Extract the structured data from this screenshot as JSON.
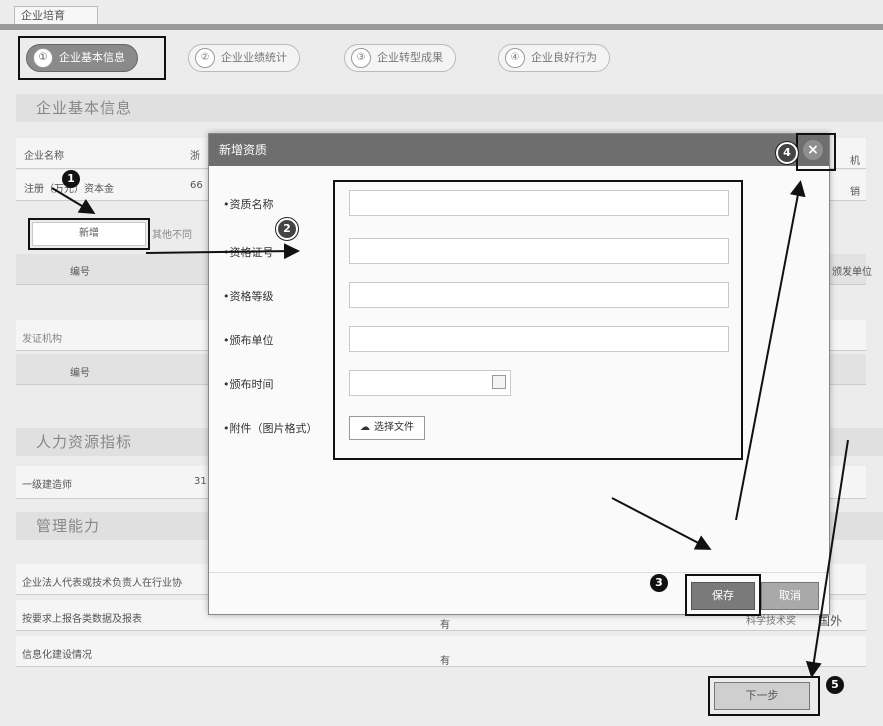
{
  "tab": {
    "label": "企业培育"
  },
  "steps": [
    {
      "num": "①",
      "label": "企业基本信息",
      "active": true
    },
    {
      "num": "②",
      "label": "企业业绩统计",
      "active": false
    },
    {
      "num": "③",
      "label": "企业转型成果",
      "active": false
    },
    {
      "num": "④",
      "label": "企业良好行为",
      "active": false
    }
  ],
  "sections": {
    "basic": "企业基本信息",
    "hr": "人力资源指标",
    "mgmt": "管理能力"
  },
  "basic_info": {
    "name_label": "企业名称",
    "name_value_partial": "浙",
    "capital_label": "注册（万元）资本金",
    "capital_value_partial": "66",
    "add_button": "新增",
    "add_hint": "其他不同",
    "col_number": "编号",
    "issuing_body": "发证机构",
    "col_number2": "编号",
    "right_label1": "机",
    "right_label2": "销",
    "right_col": "颁发单位"
  },
  "hr": {
    "row1_label": "一级建造师",
    "row1_value_partial": "31"
  },
  "mgmt": {
    "row1": "企业法人代表或技术负责人在行业协",
    "row2": "按要求上报各类数据及报表",
    "row2_value": "有",
    "row2_right": "科学技术奖",
    "row2_right2": "国外",
    "row3": "信息化建设情况",
    "row3_value": "有"
  },
  "modal": {
    "title": "新增资质",
    "close_symbol": "×",
    "fields": [
      {
        "label": "•资质名称",
        "type": "text"
      },
      {
        "label": "•资格证号",
        "type": "text"
      },
      {
        "label": "•资格等级",
        "type": "text"
      },
      {
        "label": "•颁布单位",
        "type": "text"
      },
      {
        "label": "•颁布时间",
        "type": "date"
      },
      {
        "label": "•附件（图片格式）",
        "type": "file"
      }
    ],
    "file_button": "选择文件",
    "save_button": "保存",
    "cancel_button": "取消"
  },
  "next_button": "下一步",
  "annotations": [
    "1",
    "2",
    "3",
    "4",
    "5"
  ]
}
